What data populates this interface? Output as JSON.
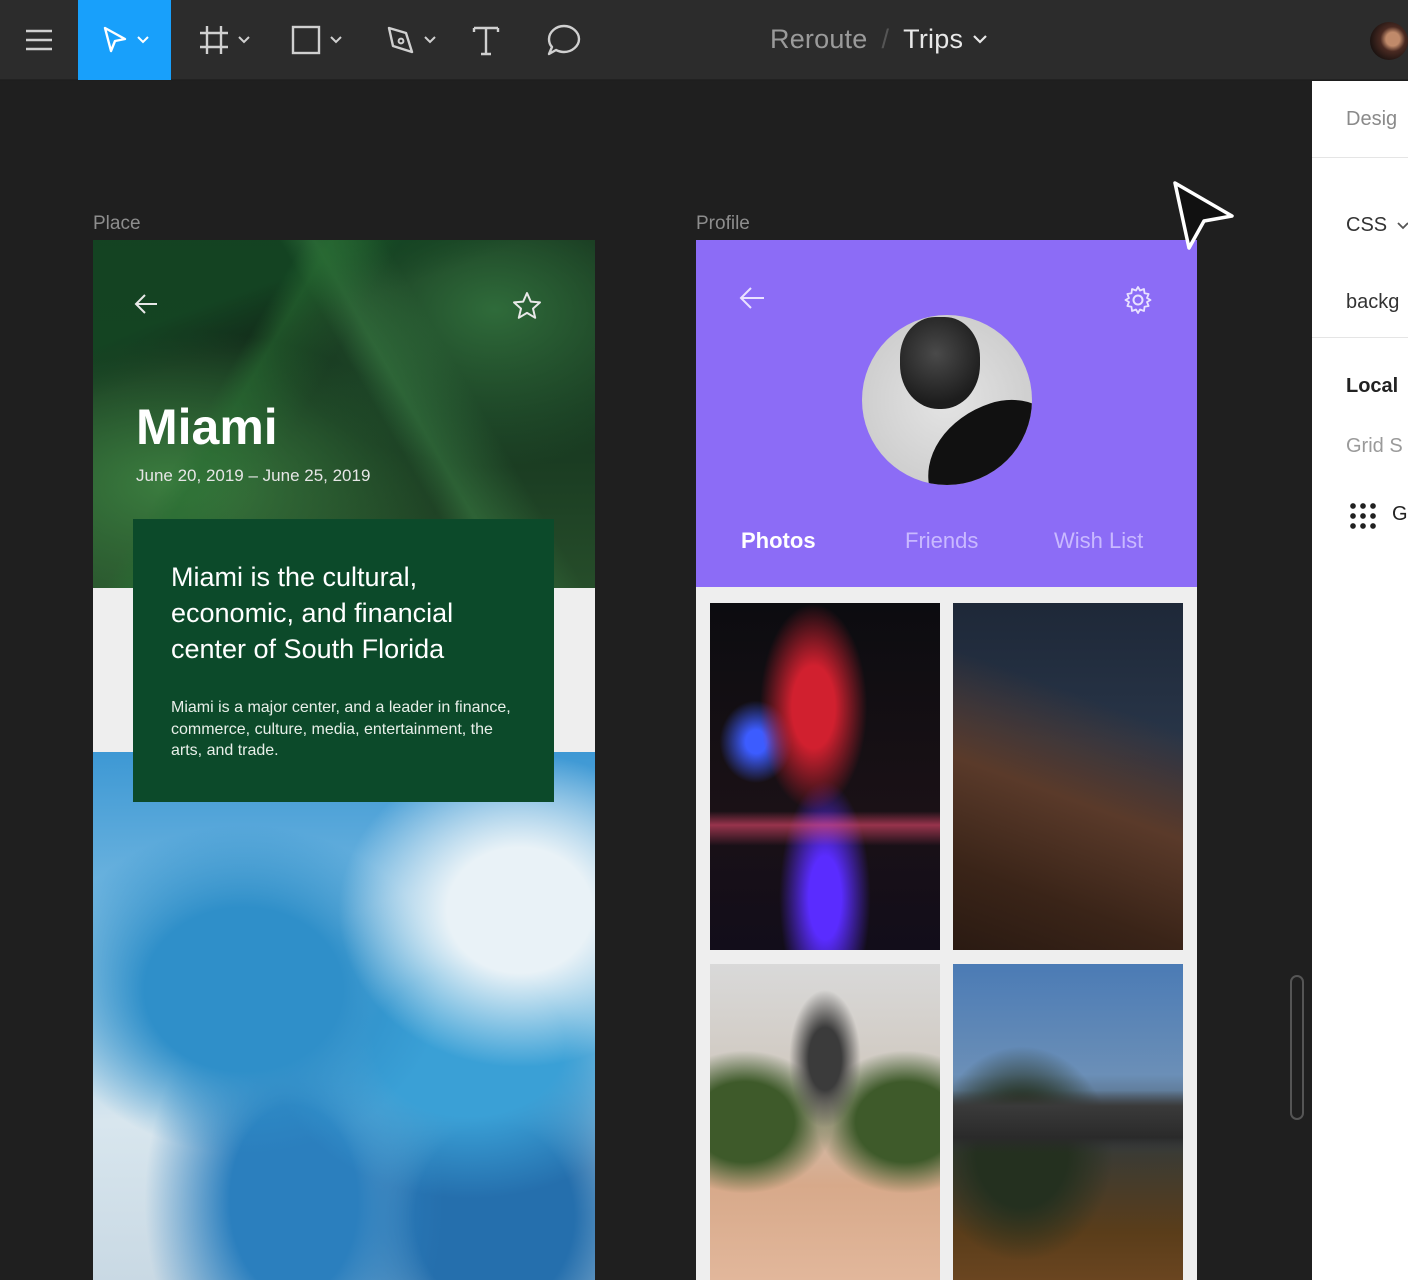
{
  "toolbar": {
    "project": "Reroute",
    "separator": "/",
    "file": "Trips",
    "active_tool": "move"
  },
  "place": {
    "frame_label": "Place",
    "city": "Miami",
    "dates": "June 20, 2019 – June 25, 2019",
    "headline": "Miami is the cultural, economic, and financial center of South Florida",
    "description": "Miami is a major center, and a leader in finance, commerce, culture, media, entertainment, the arts, and trade."
  },
  "profile": {
    "frame_label": "Profile",
    "tabs": [
      {
        "label": "Photos",
        "active": true
      },
      {
        "label": "Friends",
        "active": false
      },
      {
        "label": "Wish List",
        "active": false
      }
    ],
    "accent": "#8c6cf6"
  },
  "panel": {
    "tab": "Desig",
    "code_lang": "CSS",
    "property": "backg",
    "section": "Local",
    "subsection": "Grid S",
    "style_item": "G"
  },
  "colors": {
    "accent": "#18a0fb",
    "card_green": "#0c4a2a"
  }
}
